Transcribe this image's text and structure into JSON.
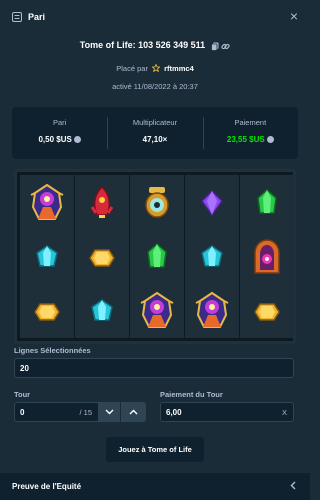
{
  "header": {
    "title": "Pari",
    "icon": "bet-slip-icon",
    "close_icon": "close-icon"
  },
  "game": {
    "title": "Tome of Life: 103 526 349 511",
    "copy_icon": "copy-icon",
    "link_icon": "link-icon"
  },
  "placed_by": {
    "prefix": "Placé par",
    "user": "rftmmc4",
    "star_icon": "star-icon"
  },
  "activated": "activé 11/08/2022 à 20:37",
  "stats": {
    "bet_label": "Pari",
    "bet_value": "0,50 $US",
    "multiplier_label": "Multiplicateur",
    "multiplier_value": "47,10×",
    "payout_label": "Paiement",
    "payout_value": "23,55 $US",
    "payout_color": "#00e701"
  },
  "board": {
    "columns": [
      [
        "wizard",
        "blue-gem",
        "yellow-gem"
      ],
      [
        "red-ship",
        "yellow-gem",
        "blue-gem"
      ],
      [
        "amulet",
        "green-gem",
        "wizard"
      ],
      [
        "purple-gem",
        "blue-gem",
        "wizard"
      ],
      [
        "green-gem",
        "portal",
        "yellow-gem"
      ]
    ]
  },
  "lines": {
    "label": "Lignes Sélectionnées",
    "value": "20"
  },
  "round": {
    "label": "Tour",
    "value": "0",
    "suffix": "/ 15"
  },
  "round_payout": {
    "label": "Paiement du Tour",
    "value": "6,00",
    "suffix": "X"
  },
  "play_button": "Jouez à Tome of Life",
  "footer": {
    "label": "Preuve de l'Equité",
    "chevron_icon": "chevron-left-icon"
  }
}
